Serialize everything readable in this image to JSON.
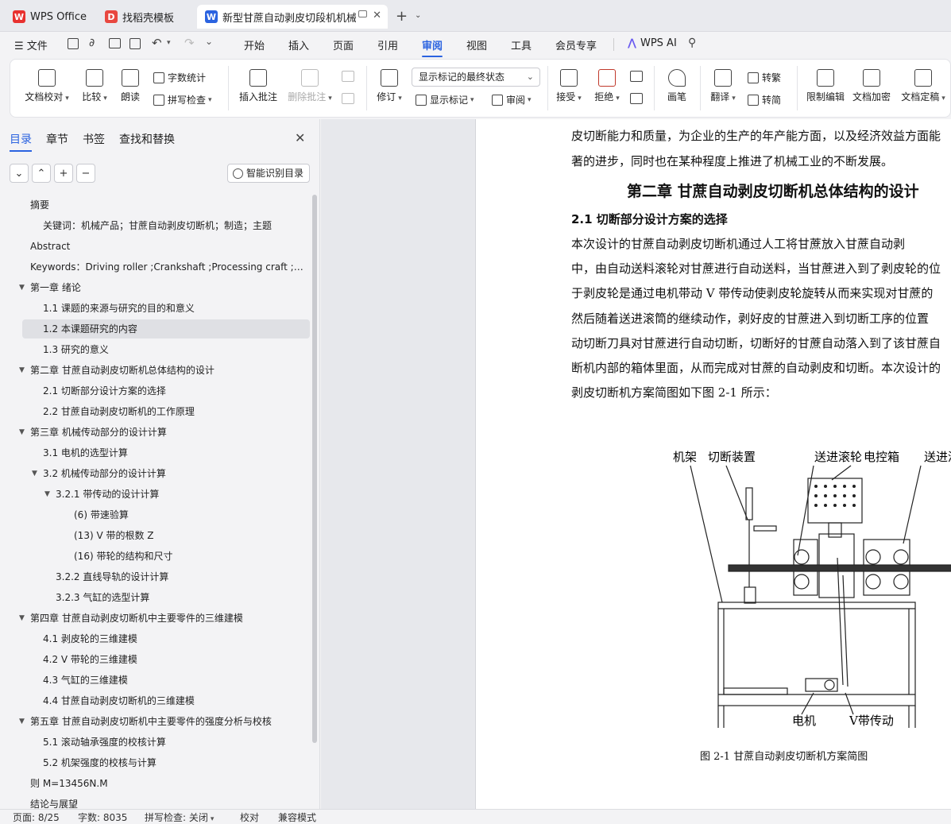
{
  "tabs": [
    {
      "label": "WPS Office",
      "icon": "wps-logo-icon"
    },
    {
      "label": "找稻壳模板",
      "icon": "docer-icon"
    },
    {
      "label": "新型甘蔗自动剥皮切段机机械",
      "icon": "writer-doc-icon"
    }
  ],
  "menu": {
    "file": "文件",
    "items": [
      "开始",
      "插入",
      "页面",
      "引用",
      "审阅",
      "视图",
      "工具",
      "会员专享"
    ],
    "active": "审阅",
    "ai": "WPS AI"
  },
  "ribbon": {
    "doc_check": "文档校对",
    "compare": "比较",
    "read_aloud": "朗读",
    "word_count": "字数统计",
    "spell_check": "拼写检查",
    "insert_comment": "插入批注",
    "delete_comment": "删除批注",
    "revise": "修订",
    "display_state": "显示标记的最终状态",
    "show_markup": "显示标记",
    "review": "审阅",
    "accept": "接受",
    "reject": "拒绝",
    "pen": "画笔",
    "translate": "翻译",
    "to_traditional": "转繁",
    "to_simplified": "转简",
    "restrict_edit": "限制编辑",
    "encrypt": "文档加密",
    "finalize": "文档定稿"
  },
  "left_panel": {
    "tabs": [
      "目录",
      "章节",
      "书签",
      "查找和替换"
    ],
    "smart_toc": "智能识别目录",
    "toc": [
      {
        "text": "摘要",
        "level": 0
      },
      {
        "text": "关键词：机械产品；甘蔗自动剥皮切断机；制造；主题",
        "level": 1
      },
      {
        "text": "Abstract",
        "level": 0
      },
      {
        "text": "Keywords：Driving roller ;Crankshaft ;Processing craft ;Si…",
        "level": 0
      },
      {
        "text": "第一章  绪论",
        "level": 0,
        "caret": true
      },
      {
        "text": "1.1  课题的来源与研究的目的和意义",
        "level": 1
      },
      {
        "text": "1.2  本课题研究的内容",
        "level": 1,
        "selected": true
      },
      {
        "text": "1.3  研究的意义",
        "level": 1
      },
      {
        "text": "第二章  甘蔗自动剥皮切断机总体结构的设计",
        "level": 0,
        "caret": true
      },
      {
        "text": "2.1 切断部分设计方案的选择",
        "level": 1
      },
      {
        "text": "2.2 甘蔗自动剥皮切断机的工作原理",
        "level": 1
      },
      {
        "text": "第三章  机械传动部分的设计计算",
        "level": 0,
        "caret": true
      },
      {
        "text": "3.1 电机的选型计算",
        "level": 1
      },
      {
        "text": "3.2  机械传动部分的设计计算",
        "level": 1,
        "caret": true
      },
      {
        "text": "3.2.1  带传动的设计计算",
        "level": 2,
        "caret": true
      },
      {
        "text": "(6)  带速验算",
        "level": 3
      },
      {
        "text": "(13)  V 带的根数 Z",
        "level": 3
      },
      {
        "text": "(16)  带轮的结构和尺寸",
        "level": 3
      },
      {
        "text": "3.2.2 直线导轨的设计计算",
        "level": 2
      },
      {
        "text": "3.2.3  气缸的选型计算",
        "level": 2
      },
      {
        "text": "第四章  甘蔗自动剥皮切断机中主要零件的三维建模",
        "level": 0,
        "caret": true
      },
      {
        "text": "4.1 剥皮轮的三维建模",
        "level": 1
      },
      {
        "text": "4.2 V 带轮的三维建模",
        "level": 1
      },
      {
        "text": "4.3 气缸的三维建模",
        "level": 1
      },
      {
        "text": "4.4 甘蔗自动剥皮切断机的三维建模",
        "level": 1
      },
      {
        "text": "第五章  甘蔗自动剥皮切断机中主要零件的强度分析与校核",
        "level": 0,
        "caret": true
      },
      {
        "text": "5.1 滚动轴承强度的校核计算",
        "level": 1
      },
      {
        "text": "5.2 机架强度的校核与计算",
        "level": 1
      },
      {
        "text": "则 M=13456N.M",
        "level": 0
      },
      {
        "text": "结论与展望",
        "level": 0
      }
    ]
  },
  "document": {
    "lines_top": [
      "皮切断能力和质量，为企业的生产的年产能方面，以及经济效益方面能",
      "著的进步，同时也在某种程度上推进了机械工业的不断发展。"
    ],
    "chapter_title": "第二章  甘蔗自动剥皮切断机总体结构的设计",
    "section_title": "2.1 切断部分设计方案的选择",
    "paragraph": [
      "    本次设计的甘蔗自动剥皮切断机通过人工将甘蔗放入甘蔗自动剥",
      "中，由自动送料滚轮对甘蔗进行自动送料，当甘蔗进入到了剥皮轮的位",
      "于剥皮轮是通过电机带动 V 带传动使剥皮轮旋转从而来实现对甘蔗的",
      "然后随着送进滚筒的继续动作，剥好皮的甘蔗进入到切断工序的位置",
      "动切断刀具对甘蔗进行自动切断，切断好的甘蔗自动落入到了该甘蔗自",
      "断机内部的箱体里面，从而完成对甘蔗的自动剥皮和切断。本次设计的",
      "剥皮切断机方案简图如下图 2-1 所示："
    ],
    "figure_labels": {
      "frame": "机架",
      "cutter": "切断装置",
      "feed_roller": "送进滚轮",
      "control_box": "电控箱",
      "feed_roller2": "送进滚",
      "motor": "电机",
      "v_belt": "V带传动"
    },
    "figure_caption": "图 2-1 甘蔗自动剥皮切断机方案简图"
  },
  "status": {
    "page": "页面: 8/25",
    "words": "字数: 8035",
    "spell": "拼写检查: 关闭",
    "proof": "校对",
    "compat": "兼容模式"
  }
}
